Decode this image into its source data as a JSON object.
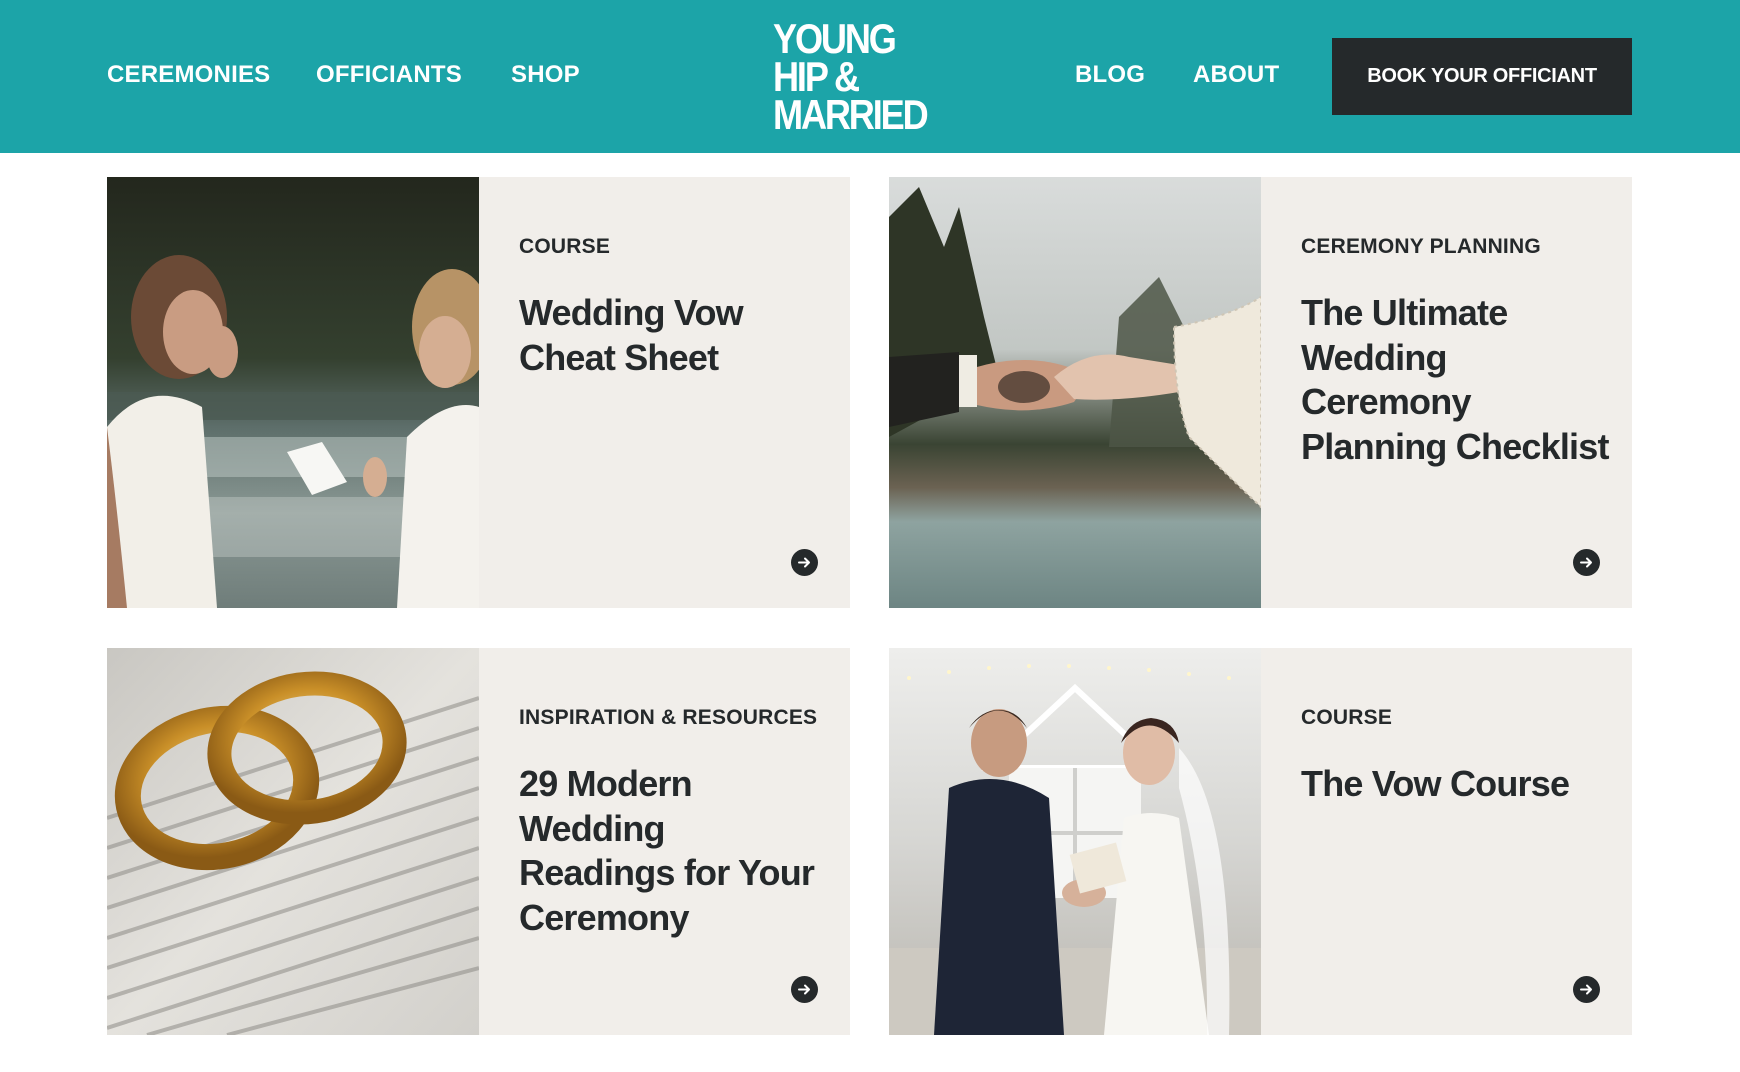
{
  "header": {
    "nav_left": [
      "CEREMONIES",
      "OFFICIANTS",
      "SHOP"
    ],
    "nav_right": [
      "BLOG",
      "ABOUT"
    ],
    "logo_lines": [
      "YOUNG",
      "HIP &",
      "MARRIED"
    ],
    "cta_label": "BOOK YOUR OFFICIANT"
  },
  "cards": [
    {
      "category": "COURSE",
      "title": "Wedding Vow Cheat Sheet",
      "image": "couple-reading-vows-by-river-photo",
      "arrow_icon": "arrow-right-circle-icon"
    },
    {
      "category": "CEREMONY PLANNING",
      "title": "The Ultimate Wedding Ceremony Planning Checklist",
      "image": "hands-holding-lake-photo",
      "arrow_icon": "arrow-right-circle-icon"
    },
    {
      "category": "INSPIRATION & RESOURCES",
      "title": "29 Modern Wedding Readings for Your Ceremony",
      "image": "gold-rings-on-dictionary-photo",
      "arrow_icon": "arrow-right-circle-icon"
    },
    {
      "category": "COURSE",
      "title": "The Vow Course",
      "image": "bride-groom-exchanging-vows-photo",
      "arrow_icon": "arrow-right-circle-icon"
    }
  ],
  "colors": {
    "header_bg": "#1ca4a8",
    "dark": "#25292b",
    "card_bg": "#f1eeea",
    "white": "#ffffff"
  }
}
